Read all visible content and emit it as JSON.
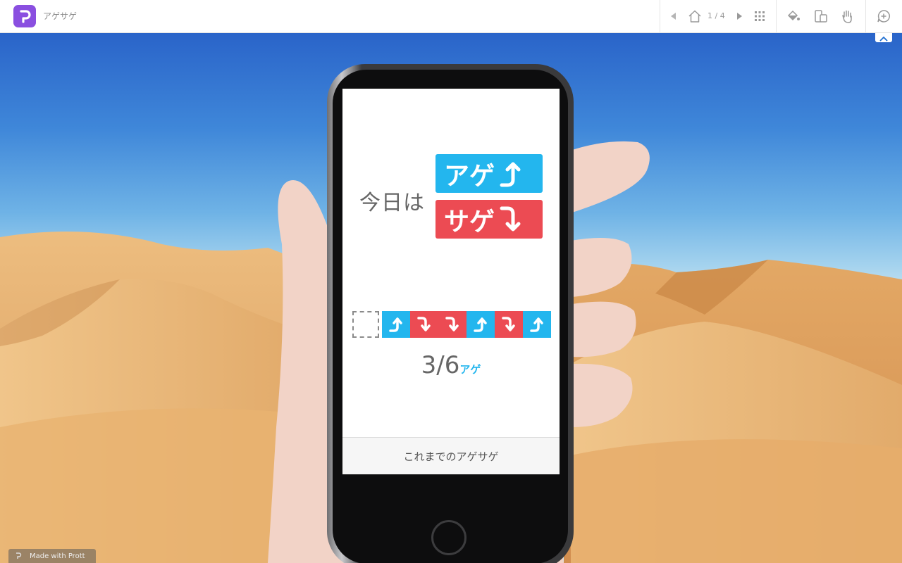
{
  "app": {
    "title": "アゲサゲ",
    "brand_color": "#8a4fe0"
  },
  "toolbar": {
    "page_indicator": "1 / 4",
    "icons": [
      "prev-page-icon",
      "home-icon",
      "next-page-icon",
      "grid-icon",
      "paint-bucket-icon",
      "device-icon",
      "hand-icon",
      "comment-add-icon",
      "collapse-icon"
    ]
  },
  "screen": {
    "today_label": "今日は",
    "up_badge": "アゲ",
    "down_badge": "サゲ",
    "history": [
      "up",
      "down",
      "down",
      "up",
      "down",
      "up"
    ],
    "count_number": "3/6",
    "count_unit": "アゲ",
    "history_button": "これまでのアゲサゲ",
    "colors": {
      "up": "#23b6ee",
      "down": "#ec4b53"
    }
  },
  "footer": {
    "made_with": "Made with Prott"
  }
}
